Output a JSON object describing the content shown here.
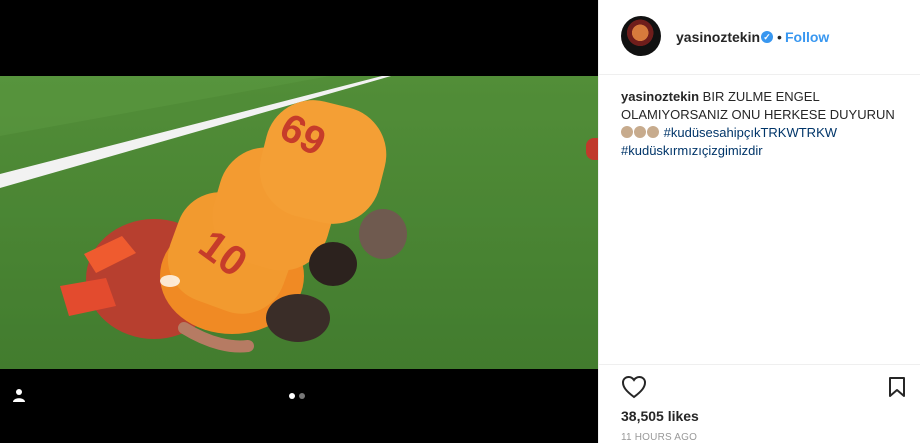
{
  "post": {
    "image_alt": "",
    "carousel": {
      "current": 1,
      "total": 2
    }
  },
  "header": {
    "username": "yasinoztekin",
    "separator": "•",
    "follow": "Follow",
    "verified_icon": "verified-badge"
  },
  "caption": {
    "username": "yasinoztekin",
    "line1": "BIR ZULME ENGEL",
    "line2": "OLAMIYORSANIZ ONU HERKESE DUYURUN",
    "hashtag1": "#kudüsesahipçıkTRKWTRKW",
    "hashtag2": "#kudüskırmızıçizgimizdir",
    "emoji_count": 3
  },
  "actions": {
    "like_icon": "heart-outline-icon",
    "save_icon": "bookmark-icon"
  },
  "stats": {
    "likes": "38,505 likes",
    "time": "11 HOURS AGO"
  },
  "colors": {
    "accent": "#3897f0",
    "hashtag": "#003569",
    "text": "#262626"
  }
}
